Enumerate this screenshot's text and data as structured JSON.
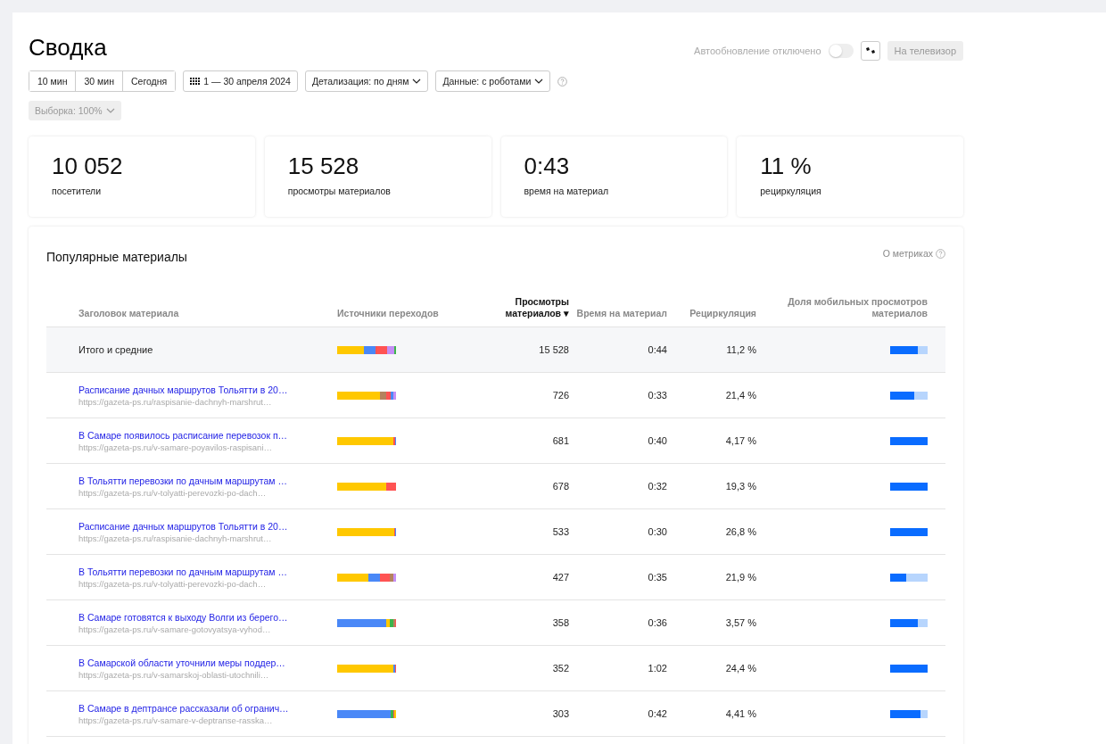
{
  "title": "Сводка",
  "autorefresh": {
    "label": "Автообновление отключено",
    "on": false
  },
  "tv_button": "На телевизор",
  "periods": [
    {
      "label": "10 мин",
      "selected": false
    },
    {
      "label": "30 мин",
      "selected": false
    },
    {
      "label": "Сегодня",
      "selected": false
    }
  ],
  "date_range": "1 — 30 апреля 2024",
  "detail_dropdown": "Детализация: по дням",
  "data_dropdown": "Данные: с роботами",
  "sample_dropdown": "Выборка: 100%",
  "metrics": [
    {
      "value": "10 052",
      "label": "посетители"
    },
    {
      "value": "15 528",
      "label": "просмотры материалов"
    },
    {
      "value": "0:43",
      "label": "время на материал"
    },
    {
      "value": "11 %",
      "label": "рециркуляция"
    }
  ],
  "popular": {
    "title": "Популярные материалы",
    "about_link": "О метриках",
    "columns": [
      {
        "label": "Заголовок материала",
        "sorted": false
      },
      {
        "label": "Источники переходов",
        "sorted": false
      },
      {
        "label": "Просмотры материалов",
        "sorted": true
      },
      {
        "label": "Время на материал",
        "sorted": false
      },
      {
        "label": "Рециркуляция",
        "sorted": false
      },
      {
        "label": "Доля мобильных просмотров материалов",
        "sorted": false
      }
    ],
    "sort_mark": "▾",
    "total": {
      "title": "Итого и средние",
      "views": "15 528",
      "time": "0:44",
      "recirculation": "11,2 %",
      "mobile": {
        "level": 0.73
      },
      "sources": [
        {
          "color": "#ffc800"
        },
        {
          "color": "#4a88f7"
        },
        {
          "color": "#ff5353"
        },
        {
          "color": "#c48ef5"
        },
        {
          "color": "#3cb54a"
        }
      ]
    },
    "rows": [
      {
        "title": "Расписание дачных маршрутов Тольятти в 20…",
        "url": "https://gazeta-ps.ru/raspisanie-dachnyh-marshrut…",
        "views": "726",
        "time": "0:33",
        "recirculation": "21,4 %",
        "mobile": {
          "level": 0.65
        },
        "sources": [
          {
            "color": "#ffc800"
          },
          {
            "color": "#b5825e"
          },
          {
            "color": "#ff5353"
          },
          {
            "color": "#4a88f7"
          },
          {
            "color": "#c48ef5"
          }
        ]
      },
      {
        "title": "В Самаре появилось расписание перевозок п…",
        "url": "https://gazeta-ps.ru/v-samare-poyavilos-raspisani…",
        "views": "681",
        "time": "0:40",
        "recirculation": "4,17 %",
        "mobile": {
          "level": 1
        },
        "sources": [
          {
            "color": "#ffc800"
          },
          {
            "color": "#ff5353"
          },
          {
            "color": "#4a88f7"
          }
        ]
      },
      {
        "title": "В Тольятти перевозки по дачным маршрутам …",
        "url": "https://gazeta-ps.ru/v-tolyatti-perevozki-po-dach…",
        "views": "678",
        "time": "0:32",
        "recirculation": "19,3 %",
        "mobile": {
          "level": 1
        },
        "sources": [
          {
            "color": "#ffc800"
          },
          {
            "color": "#ff5353"
          }
        ]
      },
      {
        "title": "Расписание дачных маршрутов Тольятти в 20…",
        "url": "https://gazeta-ps.ru/raspisanie-dachnyh-marshrut…",
        "views": "533",
        "time": "0:30",
        "recirculation": "26,8 %",
        "mobile": {
          "level": 1
        },
        "sources": [
          {
            "color": "#ffc800"
          },
          {
            "color": "#ff5353"
          },
          {
            "color": "#4a88f7"
          }
        ]
      },
      {
        "title": "В Тольятти перевозки по дачным маршрутам …",
        "url": "https://gazeta-ps.ru/v-tolyatti-perevozki-po-dach…",
        "views": "427",
        "time": "0:35",
        "recirculation": "21,9 %",
        "mobile": {
          "level": 0.42
        },
        "sources": [
          {
            "color": "#ffc800"
          },
          {
            "color": "#4a88f7"
          },
          {
            "color": "#ff5353"
          },
          {
            "color": "#b5825e"
          },
          {
            "color": "#c48ef5"
          }
        ]
      },
      {
        "title": "В Самаре готовятся к выходу Волги из берего…",
        "url": "https://gazeta-ps.ru/v-samare-gotovyatsya-vyhod…",
        "views": "358",
        "time": "0:36",
        "recirculation": "3,57 %",
        "mobile": {
          "level": 0.73
        },
        "sources": [
          {
            "color": "#4a88f7"
          },
          {
            "color": "#ffc800"
          },
          {
            "color": "#3cb54a"
          },
          {
            "color": "#b5825e"
          },
          {
            "color": "#ff5353"
          }
        ]
      },
      {
        "title": "В Самарской области уточнили меры поддер…",
        "url": "https://gazeta-ps.ru/v-samarskoj-oblasti-utochnili…",
        "views": "352",
        "time": "1:02",
        "recirculation": "24,4 %",
        "mobile": {
          "level": 1
        },
        "sources": [
          {
            "color": "#ffc800"
          },
          {
            "color": "#4a88f7"
          },
          {
            "color": "#ff5353"
          }
        ]
      },
      {
        "title": "В Самаре в дептрансе рассказали об огранич…",
        "url": "https://gazeta-ps.ru/v-samare-v-deptranse-rasska…",
        "views": "303",
        "time": "0:42",
        "recirculation": "4,41 %",
        "mobile": {
          "level": 0.82
        },
        "sources": [
          {
            "color": "#4a88f7"
          },
          {
            "color": "#3cb54a"
          },
          {
            "color": "#ff5353"
          },
          {
            "color": "#ffc800"
          }
        ]
      }
    ]
  }
}
